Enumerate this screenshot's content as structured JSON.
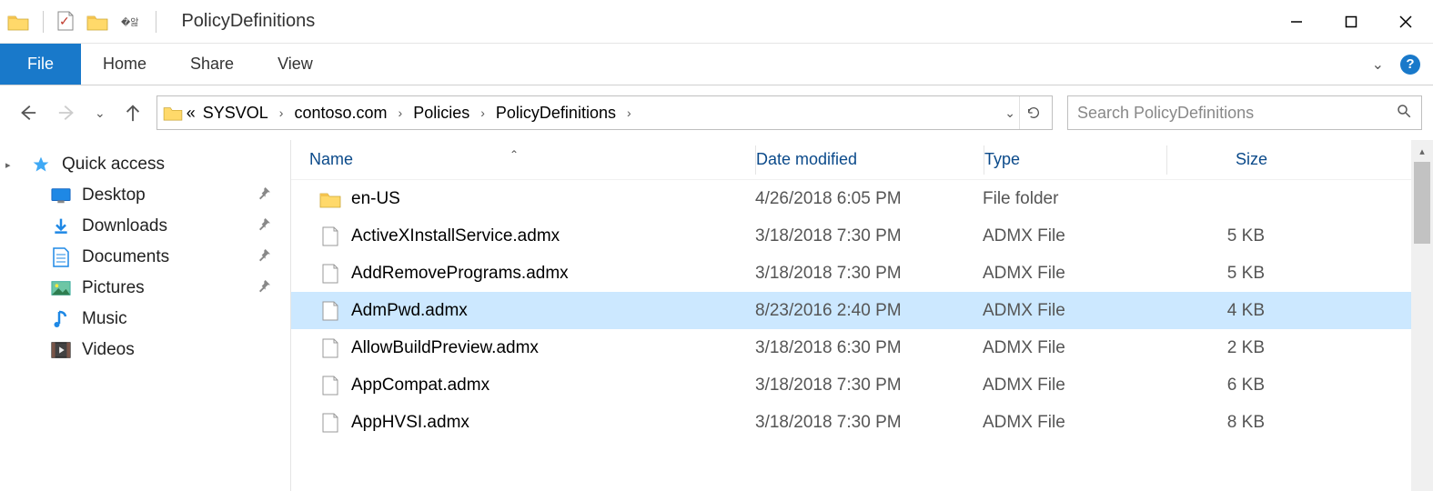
{
  "window": {
    "title": "PolicyDefinitions"
  },
  "ribbon": {
    "tabs": {
      "file": "File",
      "home": "Home",
      "share": "Share",
      "view": "View"
    }
  },
  "nav": {
    "breadcrumb_overflow": "«",
    "crumbs": [
      "SYSVOL",
      "contoso.com",
      "Policies",
      "PolicyDefinitions"
    ]
  },
  "search": {
    "placeholder": "Search PolicyDefinitions"
  },
  "sidebar": {
    "quick_access": "Quick access",
    "items": [
      {
        "label": "Desktop",
        "icon": "desktop"
      },
      {
        "label": "Downloads",
        "icon": "downloads"
      },
      {
        "label": "Documents",
        "icon": "documents"
      },
      {
        "label": "Pictures",
        "icon": "pictures"
      },
      {
        "label": "Music",
        "icon": "music"
      },
      {
        "label": "Videos",
        "icon": "videos"
      }
    ]
  },
  "columns": {
    "name": "Name",
    "date": "Date modified",
    "type": "Type",
    "size": "Size"
  },
  "files": [
    {
      "name": "en-US",
      "date": "4/26/2018 6:05 PM",
      "type": "File folder",
      "size": "",
      "icon": "folder",
      "selected": false
    },
    {
      "name": "ActiveXInstallService.admx",
      "date": "3/18/2018 7:30 PM",
      "type": "ADMX File",
      "size": "5 KB",
      "icon": "file",
      "selected": false
    },
    {
      "name": "AddRemovePrograms.admx",
      "date": "3/18/2018 7:30 PM",
      "type": "ADMX File",
      "size": "5 KB",
      "icon": "file",
      "selected": false
    },
    {
      "name": "AdmPwd.admx",
      "date": "8/23/2016 2:40 PM",
      "type": "ADMX File",
      "size": "4 KB",
      "icon": "file",
      "selected": true
    },
    {
      "name": "AllowBuildPreview.admx",
      "date": "3/18/2018 6:30 PM",
      "type": "ADMX File",
      "size": "2 KB",
      "icon": "file",
      "selected": false
    },
    {
      "name": "AppCompat.admx",
      "date": "3/18/2018 7:30 PM",
      "type": "ADMX File",
      "size": "6 KB",
      "icon": "file",
      "selected": false
    },
    {
      "name": "AppHVSI.admx",
      "date": "3/18/2018 7:30 PM",
      "type": "ADMX File",
      "size": "8 KB",
      "icon": "file",
      "selected": false
    }
  ]
}
